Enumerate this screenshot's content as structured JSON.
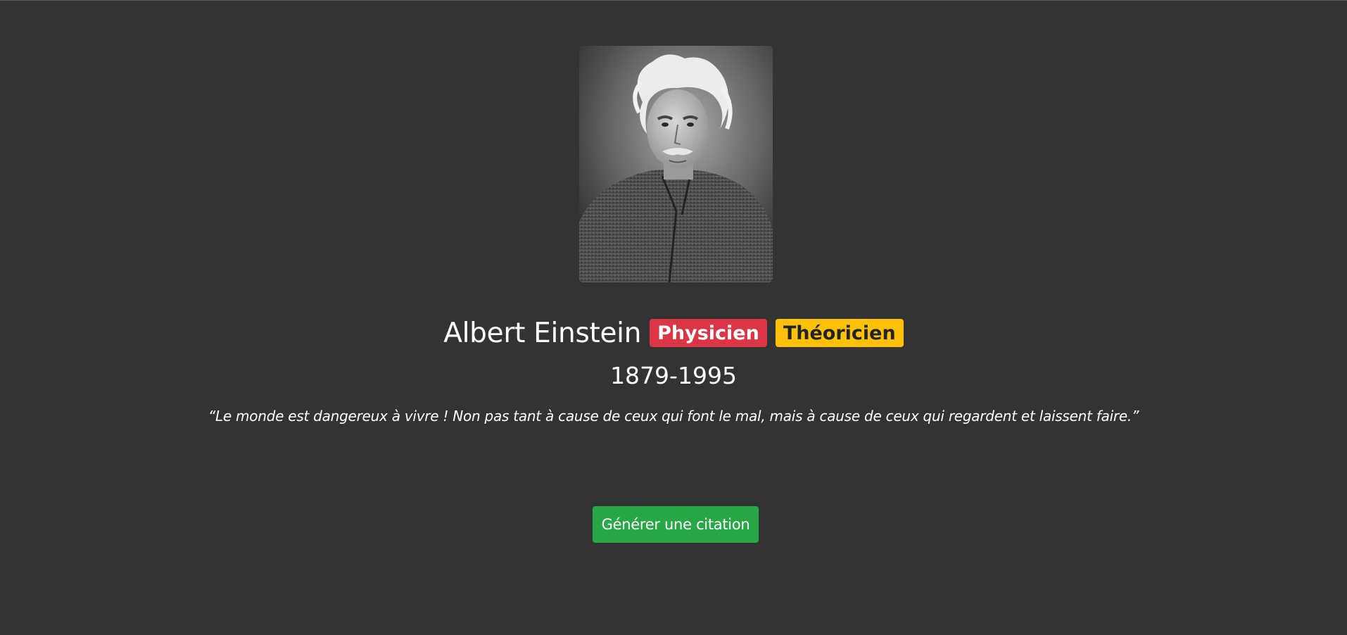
{
  "portrait": {
    "icon": "person-portrait-photo"
  },
  "person": {
    "name": "Albert Einstein",
    "years": "1879-1995",
    "quote": "“Le monde est dangereux à vivre ! Non pas tant à cause de ceux qui font le mal, mais à cause de ceux qui regardent et laissent faire.”"
  },
  "badges": [
    {
      "label": "Physicien",
      "bg": "#dc3545",
      "color": "#ffffff"
    },
    {
      "label": "Théoricien",
      "bg": "#ffc107",
      "color": "#212529"
    }
  ],
  "actions": {
    "generate_label": "Générer une citation",
    "generate_color": "#28a745"
  },
  "colors": {
    "background": "#333333",
    "text": "#ffffff"
  }
}
